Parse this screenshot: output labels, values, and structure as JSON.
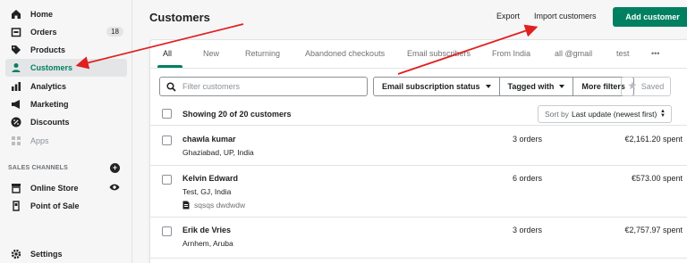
{
  "sidebar": {
    "items": [
      {
        "label": "Home",
        "icon": "home-icon"
      },
      {
        "label": "Orders",
        "icon": "orders-icon",
        "badge": "18"
      },
      {
        "label": "Products",
        "icon": "tag-icon"
      },
      {
        "label": "Customers",
        "icon": "person-icon"
      },
      {
        "label": "Analytics",
        "icon": "bar-chart-icon"
      },
      {
        "label": "Marketing",
        "icon": "megaphone-icon"
      },
      {
        "label": "Discounts",
        "icon": "discount-icon"
      },
      {
        "label": "Apps",
        "icon": "apps-icon"
      }
    ],
    "section_title": "SALES CHANNELS",
    "channels": [
      {
        "label": "Online Store",
        "icon": "store-icon"
      },
      {
        "label": "Point of Sale",
        "icon": "pos-icon"
      }
    ],
    "settings_label": "Settings"
  },
  "header": {
    "title": "Customers",
    "export_label": "Export",
    "import_label": "Import customers",
    "add_label": "Add customer"
  },
  "tabs": [
    "All",
    "New",
    "Returning",
    "Abandoned checkouts",
    "Email subscribers",
    "From India",
    "all @gmail",
    "test",
    "•••"
  ],
  "filters": {
    "search_placeholder": "Filter customers",
    "email_status_label": "Email subscription status",
    "tagged_with_label": "Tagged with",
    "more_filters_label": "More filters",
    "saved_label": "Saved"
  },
  "selection": {
    "text": "Showing 20 of 20 customers",
    "sort_prefix": "Sort by",
    "sort_value": "Last update (newest first)"
  },
  "customers": [
    {
      "name": "chawla kumar",
      "location": "Ghaziabad, UP, India",
      "orders": "3 orders",
      "spent": "€2,161.20 spent",
      "note": ""
    },
    {
      "name": "Kelvin Edward",
      "location": "Test, GJ, India",
      "orders": "6 orders",
      "spent": "€573.00 spent",
      "note": "sqsqs dwdwdw"
    },
    {
      "name": "Erik de Vries",
      "location": "Arnhem, Aruba",
      "orders": "3 orders",
      "spent": "€2,757.97 spent",
      "note": ""
    }
  ],
  "colors": {
    "accent": "#008060",
    "annotation": "#e02020"
  }
}
